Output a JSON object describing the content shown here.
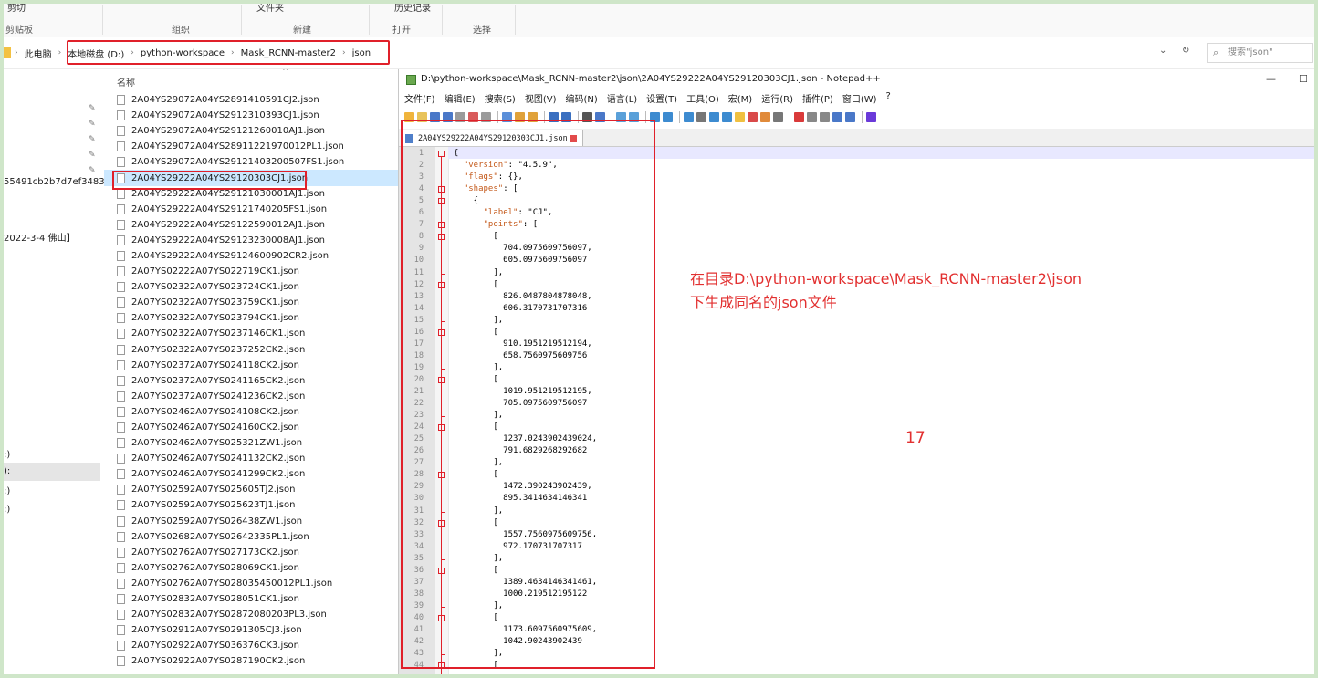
{
  "ribbon": {
    "top_items": [
      "剪切",
      "文件夹",
      "历史记录"
    ],
    "groups": [
      "剪贴板",
      "组织",
      "新建",
      "打开",
      "选择"
    ]
  },
  "address": {
    "crumbs": [
      "此电脑",
      "本地磁盘 (D:)",
      "python-workspace",
      "Mask_RCNN-master2",
      "json"
    ],
    "search_placeholder": "搜索\"json\""
  },
  "nav": {
    "items": [
      {
        "text": "55491cb2b7d7ef3483"
      },
      {
        "text": "2022-3-4 佛山】"
      },
      {
        "text": ":)"
      },
      {
        "text": "):"
      },
      {
        "text": ":)"
      },
      {
        "text": ":)"
      }
    ]
  },
  "file_list": {
    "column_header": "名称",
    "files": [
      "2A04YS29072A04YS2891410591CJ2.json",
      "2A04YS29072A04YS2912310393CJ1.json",
      "2A04YS29072A04YS29121260010AJ1.json",
      "2A04YS29072A04YS28911221970012PL1.json",
      "2A04YS29072A04YS29121403200507FS1.json",
      "2A04YS29222A04YS29120303CJ1.json",
      "2A04YS29222A04YS29121030001AJ1.json",
      "2A04YS29222A04YS29121740205FS1.json",
      "2A04YS29222A04YS29122590012AJ1.json",
      "2A04YS29222A04YS29123230008AJ1.json",
      "2A04YS29222A04YS29124600902CR2.json",
      "2A07YS02222A07YS022719CK1.json",
      "2A07YS02322A07YS023724CK1.json",
      "2A07YS02322A07YS023759CK1.json",
      "2A07YS02322A07YS023794CK1.json",
      "2A07YS02322A07YS0237146CK1.json",
      "2A07YS02322A07YS0237252CK2.json",
      "2A07YS02372A07YS024118CK2.json",
      "2A07YS02372A07YS0241165CK2.json",
      "2A07YS02372A07YS0241236CK2.json",
      "2A07YS02462A07YS024108CK2.json",
      "2A07YS02462A07YS024160CK2.json",
      "2A07YS02462A07YS025321ZW1.json",
      "2A07YS02462A07YS0241132CK2.json",
      "2A07YS02462A07YS0241299CK2.json",
      "2A07YS02592A07YS025605TJ2.json",
      "2A07YS02592A07YS025623TJ1.json",
      "2A07YS02592A07YS026438ZW1.json",
      "2A07YS02682A07YS02642335PL1.json",
      "2A07YS02762A07YS027173CK2.json",
      "2A07YS02762A07YS028069CK1.json",
      "2A07YS02762A07YS028035450012PL1.json",
      "2A07YS02832A07YS028051CK1.json",
      "2A07YS02832A07YS02872080203PL3.json",
      "2A07YS02912A07YS0291305CJ3.json",
      "2A07YS02922A07YS036376CK3.json",
      "2A07YS02922A07YS0287190CK2.json"
    ],
    "selected_index": 5
  },
  "notepad": {
    "title": "D:\\python-workspace\\Mask_RCNN-master2\\json\\2A04YS29222A04YS29120303CJ1.json - Notepad++",
    "menu": [
      "文件(F)",
      "编辑(E)",
      "搜索(S)",
      "视图(V)",
      "编码(N)",
      "语言(L)",
      "设置(T)",
      "工具(O)",
      "宏(M)",
      "运行(R)",
      "插件(P)",
      "窗口(W)",
      "?"
    ],
    "tab_label": "2A04YS29222A04YS29120303CJ1.json",
    "lines": [
      "{",
      "  \"version\": \"4.5.9\",",
      "  \"flags\": {},",
      "  \"shapes\": [",
      "    {",
      "      \"label\": \"CJ\",",
      "      \"points\": [",
      "        [",
      "          704.0975609756097,",
      "          605.0975609756097",
      "        ],",
      "        [",
      "          826.0487804878048,",
      "          606.3170731707316",
      "        ],",
      "        [",
      "          910.1951219512194,",
      "          658.7560975609756",
      "        ],",
      "        [",
      "          1019.951219512195,",
      "          705.0975609756097",
      "        ],",
      "        [",
      "          1237.0243902439024,",
      "          791.6829268292682",
      "        ],",
      "        [",
      "          1472.390243902439,",
      "          895.3414634146341",
      "        ],",
      "        [",
      "          1557.7560975609756,",
      "          972.170731707317",
      "        ],",
      "        [",
      "          1389.4634146341461,",
      "          1000.219512195122",
      "        ],",
      "        [",
      "          1173.6097560975609,",
      "          1042.90243902439",
      "        ],",
      "        ["
    ]
  },
  "annotation": {
    "line1": "在目录D:\\python-workspace\\Mask_RCNN-master2\\json",
    "line2": "下生成同名的json文件",
    "page_number": "17"
  },
  "colors": {
    "highlight": "#e0202a",
    "annotation_text": "#e23030",
    "json_key": "#c4591a",
    "selection": "#cce8ff"
  }
}
